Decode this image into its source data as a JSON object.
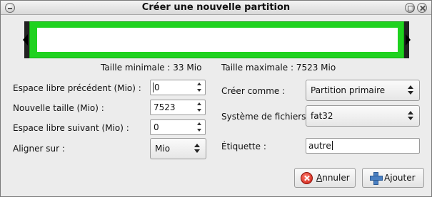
{
  "window": {
    "title": "Créer une nouvelle partition"
  },
  "partition_visual": {
    "color": "#1fd21f"
  },
  "sizes": {
    "min_label": "Taille minimale : 33 Mio",
    "max_label": "Taille maximale : 7523 Mio"
  },
  "left_fields": {
    "free_before_label": "Espace libre précédent (Mio) :",
    "free_before_value": "0",
    "new_size_label": "Nouvelle taille (Mio) :",
    "new_size_value": "7523",
    "free_after_label": "Espace libre suivant (Mio) :",
    "free_after_value": "0",
    "align_label": "Aligner sur :",
    "align_value": "Mio"
  },
  "right_fields": {
    "create_as_label": "Créer comme :",
    "create_as_value": "Partition primaire",
    "filesystem_label": "Système de fichiers :",
    "filesystem_value": "fat32",
    "label_label": "Étiquette :",
    "label_value": "autre"
  },
  "buttons": {
    "cancel_pre": "",
    "cancel_ul": "A",
    "cancel_post": "nnuler",
    "add_pre": "A",
    "add_ul": "j",
    "add_post": "outer"
  },
  "icons": {
    "cancel": "cancel-icon",
    "add": "add-icon"
  }
}
